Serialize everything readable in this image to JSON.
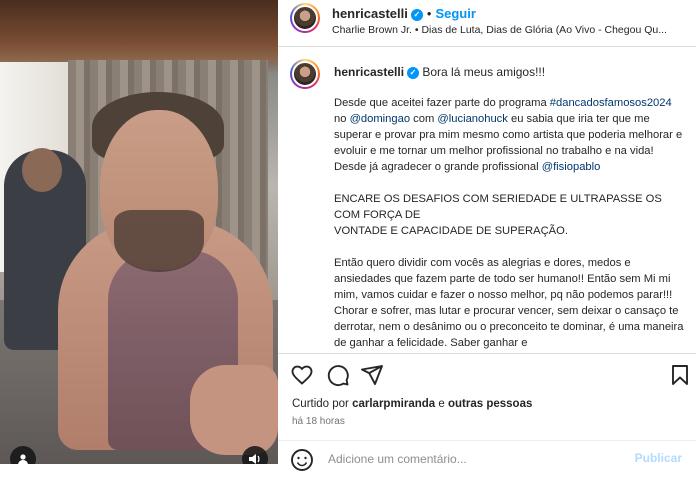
{
  "post": {
    "username": "henricastelli",
    "follow_label": "Seguir",
    "separator": "•",
    "music": "Charlie Brown Jr. • Dias de Luta, Dias de Glória (Ao Vivo - Chegou Qu...",
    "first_line": "Bora lá meus amigos!!!",
    "caption": {
      "p1_a": "Desde que aceitei fazer parte do programa ",
      "p1_tag": "#dancadosfamosos2024",
      "p1_b": " no ",
      "p1_mention1": "@domingao",
      "p1_c": " com ",
      "p1_mention2": "@lucianohuck",
      "p1_d": " eu sabia que iria ter que me superar e provar pra mim mesmo como artista que poderia melhorar e evoluir e me tornar um melhor profissional no trabalho e na vida! Desde já agradecer o grande profissional ",
      "p1_mention3": "@fisiopablo",
      "p2_line1": "ENCARE OS DESAFIOS COM SERIEDADE E ULTRAPASSE OS COM FORÇA DE",
      "p2_line2": "VONTADE E CAPACIDADE DE SUPERAÇÃO.",
      "p3": "Então quero dividir com vocês as alegrias e dores, medos e ansiedades que fazem parte de todo ser humano!! Então sem Mi mi mim, vamos cuidar e fazer o nosso melhor, pq não podemos parar!!! Chorar e sofrer, mas lutar e procurar vencer, sem deixar o cansaço te derrotar, nem o desânimo ou o preconceito te dominar, é uma maneira de ganhar a felicidade. Saber ganhar e"
    },
    "likes_prefix": "Curtido por ",
    "likes_user": "carlarpmiranda",
    "likes_suffix": " e ",
    "likes_others": "outras pessoas",
    "time_ago": "há 18 horas",
    "comment_placeholder": "Adicione um comentário...",
    "publish_label": "Publicar"
  },
  "icons": {
    "like": "heart-icon",
    "comment": "comment-icon",
    "share": "share-icon",
    "save": "bookmark-icon",
    "emoji": "emoji-icon",
    "verified": "verified-icon",
    "user_tag": "user-tag-icon",
    "audio": "speaker-icon"
  },
  "colors": {
    "link": "#00376b",
    "accent": "#0095f6"
  }
}
